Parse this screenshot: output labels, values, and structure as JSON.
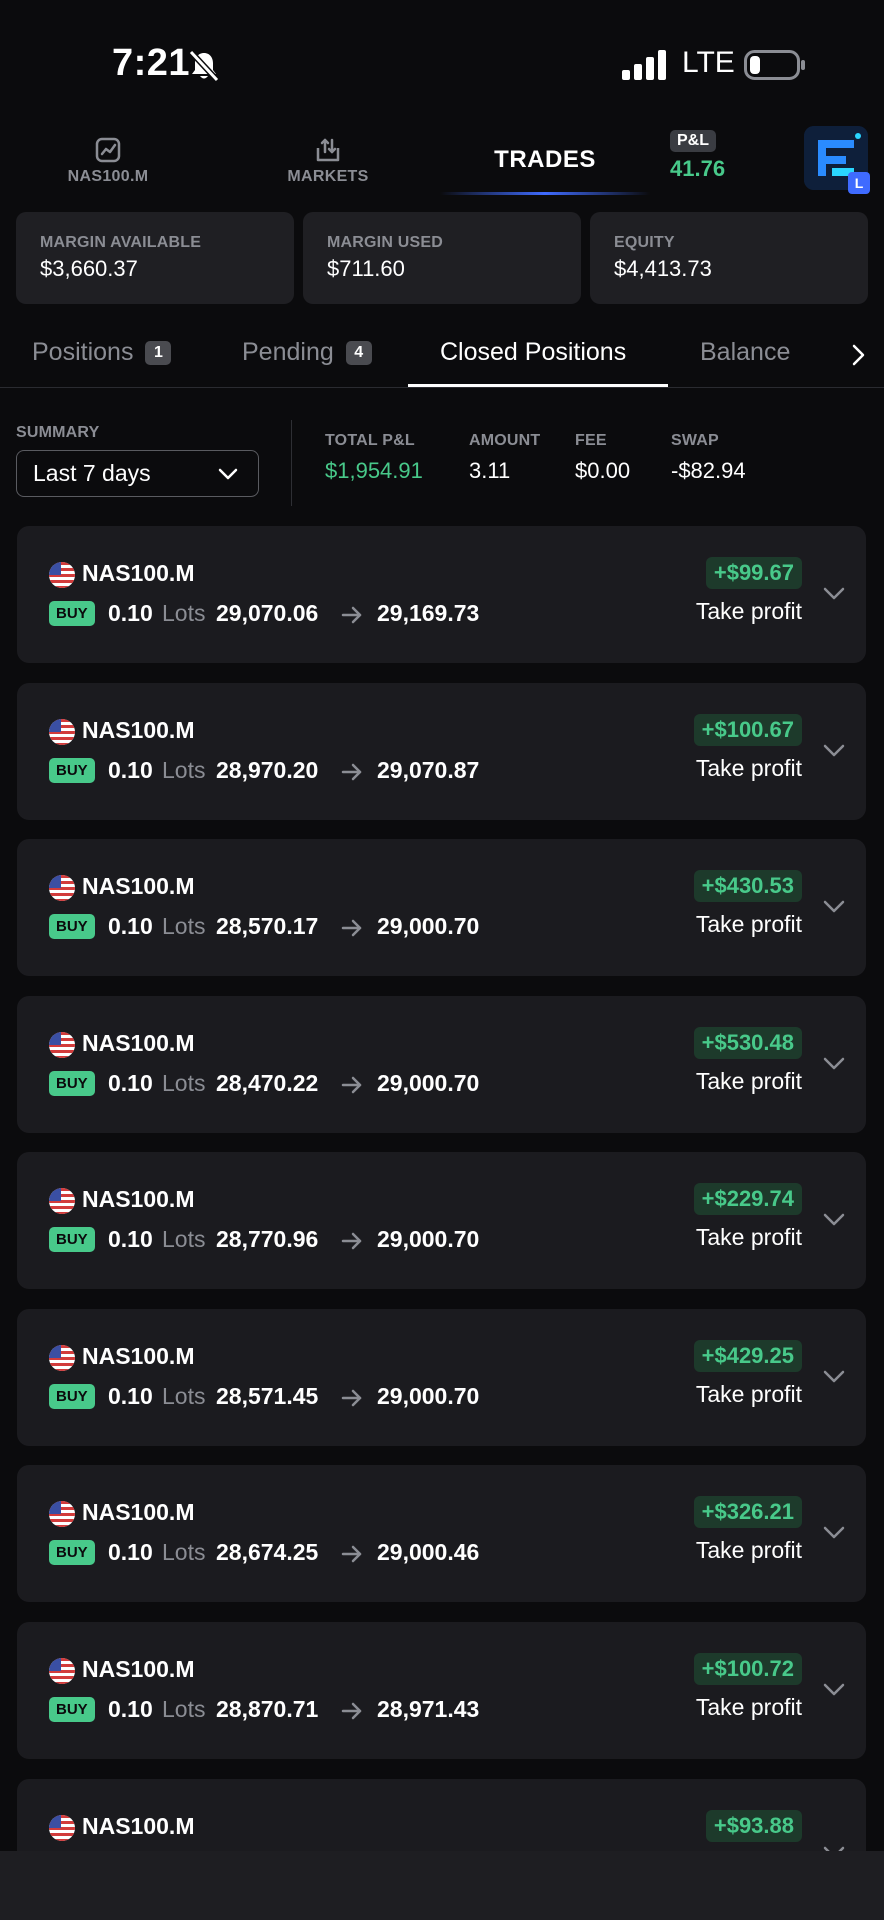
{
  "status_bar": {
    "time": "7:21",
    "network": "LTE"
  },
  "top_nav": {
    "items": [
      {
        "label": "NAS100.M",
        "icon": "chart-icon"
      },
      {
        "label": "MARKETS",
        "icon": "transfer-icon"
      },
      {
        "label": "TRADES",
        "active": true
      }
    ],
    "pnl_label": "P&L",
    "pnl_value": "41.76",
    "account_badge": "L"
  },
  "margin": {
    "available_label": "MARGIN AVAILABLE",
    "available_value": "$3,660.37",
    "used_label": "MARGIN USED",
    "used_value": "$711.60",
    "equity_label": "EQUITY",
    "equity_value": "$4,413.73"
  },
  "tabs": [
    {
      "label": "Positions",
      "count": "1"
    },
    {
      "label": "Pending",
      "count": "4"
    },
    {
      "label": "Closed Positions",
      "active": true
    },
    {
      "label": "Balance"
    }
  ],
  "summary": {
    "label": "SUMMARY",
    "period": "Last 7 days",
    "total_pnl_label": "TOTAL P&L",
    "total_pnl_value": "$1,954.91",
    "amount_label": "AMOUNT",
    "amount_value": "3.11",
    "fee_label": "FEE",
    "fee_value": "$0.00",
    "swap_label": "SWAP",
    "swap_value": "-$82.94"
  },
  "positions": [
    {
      "symbol": "NAS100.M",
      "side": "BUY",
      "lots": "0.10",
      "lots_label": "Lots",
      "open": "29,070.06",
      "close": "29,169.73",
      "pnl": "+$99.67",
      "reason": "Take profit"
    },
    {
      "symbol": "NAS100.M",
      "side": "BUY",
      "lots": "0.10",
      "lots_label": "Lots",
      "open": "28,970.20",
      "close": "29,070.87",
      "pnl": "+$100.67",
      "reason": "Take profit"
    },
    {
      "symbol": "NAS100.M",
      "side": "BUY",
      "lots": "0.10",
      "lots_label": "Lots",
      "open": "28,570.17",
      "close": "29,000.70",
      "pnl": "+$430.53",
      "reason": "Take profit"
    },
    {
      "symbol": "NAS100.M",
      "side": "BUY",
      "lots": "0.10",
      "lots_label": "Lots",
      "open": "28,470.22",
      "close": "29,000.70",
      "pnl": "+$530.48",
      "reason": "Take profit"
    },
    {
      "symbol": "NAS100.M",
      "side": "BUY",
      "lots": "0.10",
      "lots_label": "Lots",
      "open": "28,770.96",
      "close": "29,000.70",
      "pnl": "+$229.74",
      "reason": "Take profit"
    },
    {
      "symbol": "NAS100.M",
      "side": "BUY",
      "lots": "0.10",
      "lots_label": "Lots",
      "open": "28,571.45",
      "close": "29,000.70",
      "pnl": "+$429.25",
      "reason": "Take profit"
    },
    {
      "symbol": "NAS100.M",
      "side": "BUY",
      "lots": "0.10",
      "lots_label": "Lots",
      "open": "28,674.25",
      "close": "29,000.46",
      "pnl": "+$326.21",
      "reason": "Take profit"
    },
    {
      "symbol": "NAS100.M",
      "side": "BUY",
      "lots": "0.10",
      "lots_label": "Lots",
      "open": "28,870.71",
      "close": "28,971.43",
      "pnl": "+$100.72",
      "reason": "Take profit"
    },
    {
      "symbol": "NAS100.M",
      "pnl": "+$93.88"
    }
  ],
  "colors": {
    "accent_green": "#48c98a",
    "accent_blue": "#3f6bff",
    "background": "#0b0b0d",
    "card": "#1b1b1f"
  }
}
